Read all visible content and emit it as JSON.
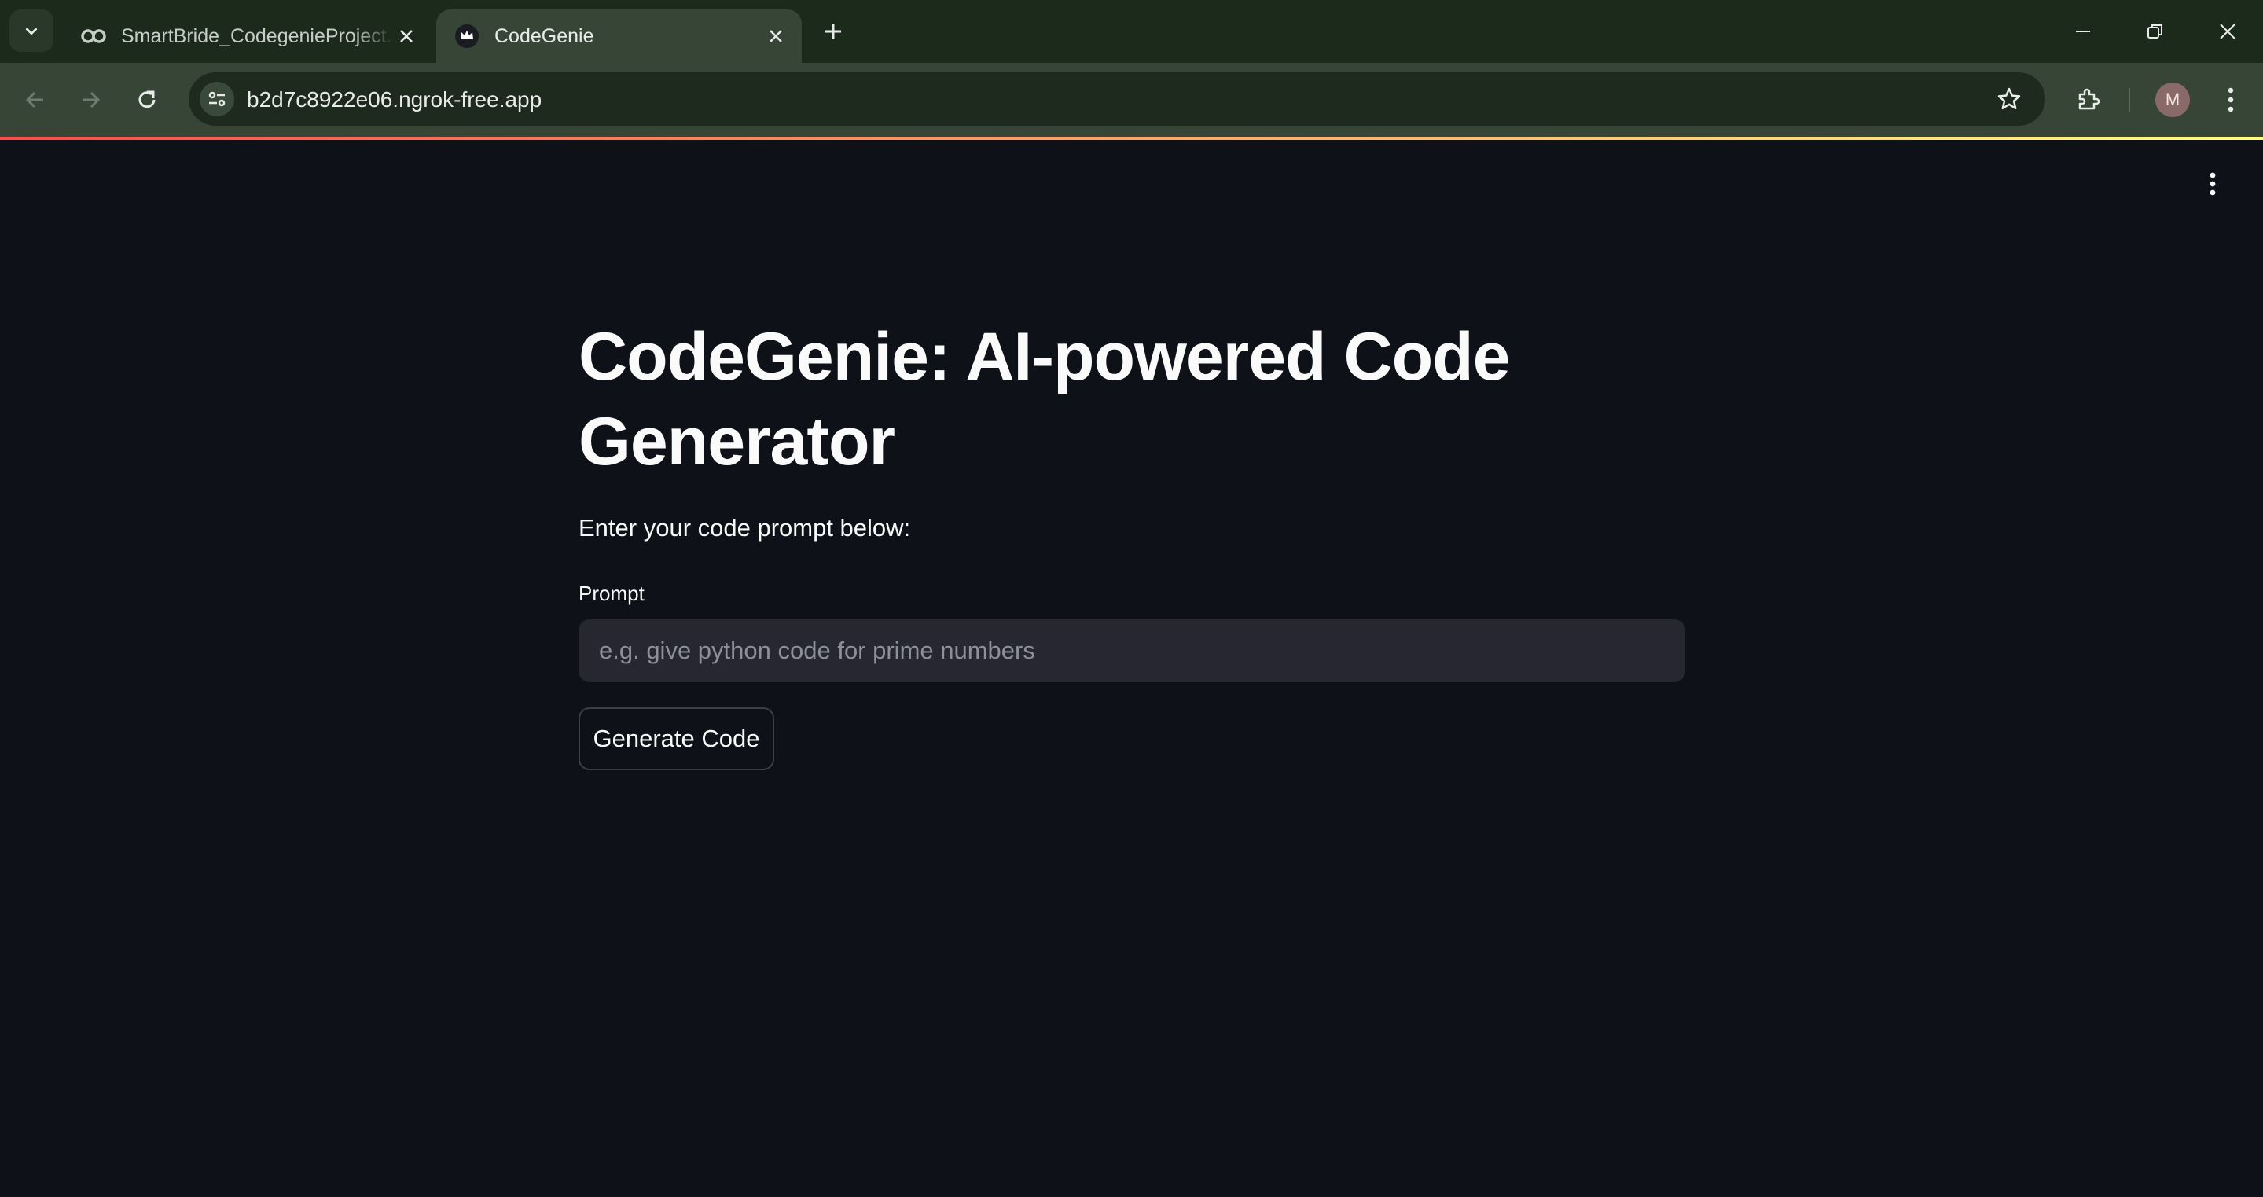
{
  "browser": {
    "tabs": [
      {
        "title": "SmartBride_CodegenieProject.ipynb",
        "icon": "colab-icon",
        "active": false
      },
      {
        "title": "CodeGenie",
        "icon": "streamlit-crown-icon",
        "active": true
      }
    ],
    "url": "b2d7c8922e06.ngrok-free.app",
    "profile_initial": "M"
  },
  "app": {
    "title": "CodeGenie: AI-powered Code Generator",
    "subtitle": "Enter your code prompt below:",
    "prompt_label": "Prompt",
    "prompt_placeholder": "e.g. give python code for prime numbers",
    "prompt_value": "",
    "generate_button": "Generate Code"
  },
  "colors": {
    "background": "#0e1117",
    "input_bg": "#262730",
    "text": "#fafafa",
    "accent_gradient_start": "#ff4b4b",
    "accent_gradient_end": "#fffd80"
  }
}
